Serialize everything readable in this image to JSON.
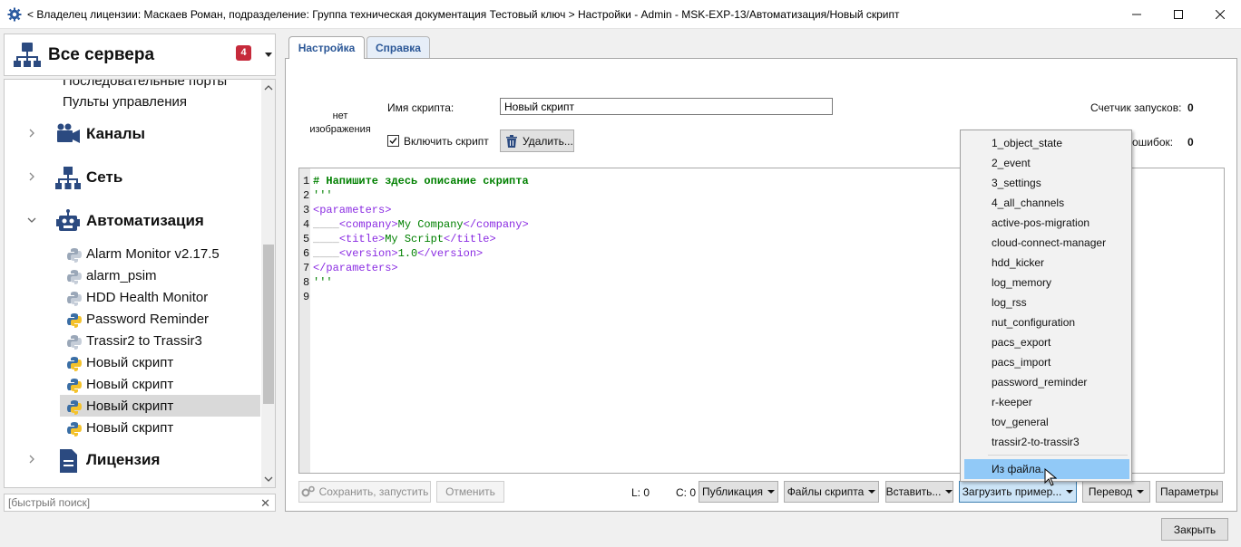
{
  "window": {
    "title": "< Владелец лицензии: Маскаев Роман, подразделение: Группа техническая документация Тестовый ключ > Настройки - Admin - MSK-EXP-13/Автоматизация/Новый скрипт"
  },
  "sidebar": {
    "servers_title": "Все сервера",
    "servers_badge": "4",
    "tree": {
      "partial_item": "Последовательные порты",
      "remote_controls": "Пульты управления",
      "channels": "Каналы",
      "network": "Сеть",
      "automation": "Автоматизация",
      "scripts": [
        "Alarm Monitor v2.17.5",
        "alarm_psim",
        "HDD Health Monitor",
        "Password Reminder",
        "Trassir2 to Trassir3",
        "Новый скрипт",
        "Новый скрипт",
        "Новый скрипт",
        "Новый скрипт"
      ],
      "license": "Лицензия"
    },
    "search_placeholder": "[быстрый поиск]"
  },
  "tabs": {
    "settings": "Настройка",
    "help": "Справка"
  },
  "form": {
    "no_image": "нет изображения",
    "script_name_label": "Имя скрипта:",
    "script_name_value": "Новый скрипт",
    "enable_label": "Включить скрипт",
    "delete_button": "Удалить...",
    "launch_counter_label": "Счетчик запусков:",
    "launch_counter_value": "0",
    "errors_label": "ошибок:",
    "errors_value": "0"
  },
  "editor": {
    "lines": [
      "1",
      "2",
      "3",
      "4",
      "5",
      "6",
      "7",
      "8",
      "9"
    ],
    "comment": "# Напишите здесь описание скрипта",
    "quote": "'''",
    "params_open": "<parameters>",
    "ws": "____",
    "company_open": "<company>",
    "company_val": "My Company",
    "company_close": "</company>",
    "title_open": "<title>",
    "title_val": "My Script",
    "title_close": "</title>",
    "version_open": "<version>",
    "version_val": "1.0",
    "version_close": "</version>",
    "params_close": "</parameters>"
  },
  "toolbar": {
    "save_run": "Сохранить, запустить",
    "cancel": "Отменить",
    "line_label": "L: 0",
    "col_label": "C: 0",
    "publication": "Публикация",
    "script_files": "Файлы скрипта",
    "insert": "Вставить...",
    "load_example": "Загрузить пример...",
    "translate": "Перевод",
    "params": "Параметры",
    "close": "Закрыть"
  },
  "menu": {
    "items": [
      "1_object_state",
      "2_event",
      "3_settings",
      "4_all_channels",
      "active-pos-migration",
      "cloud-connect-manager",
      "hdd_kicker",
      "log_memory",
      "log_rss",
      "nut_configuration",
      "pacs_export",
      "pacs_import",
      "password_reminder",
      "r-keeper",
      "tov_general",
      "trassir2-to-trassir3"
    ],
    "from_file": "Из файла..."
  },
  "colors": {
    "accent_tab": "#2b5797",
    "badge": "#c62a3b",
    "menu_highlight": "#91c9f7",
    "comment_green": "#008000",
    "tag_purple": "#8a2be2"
  }
}
